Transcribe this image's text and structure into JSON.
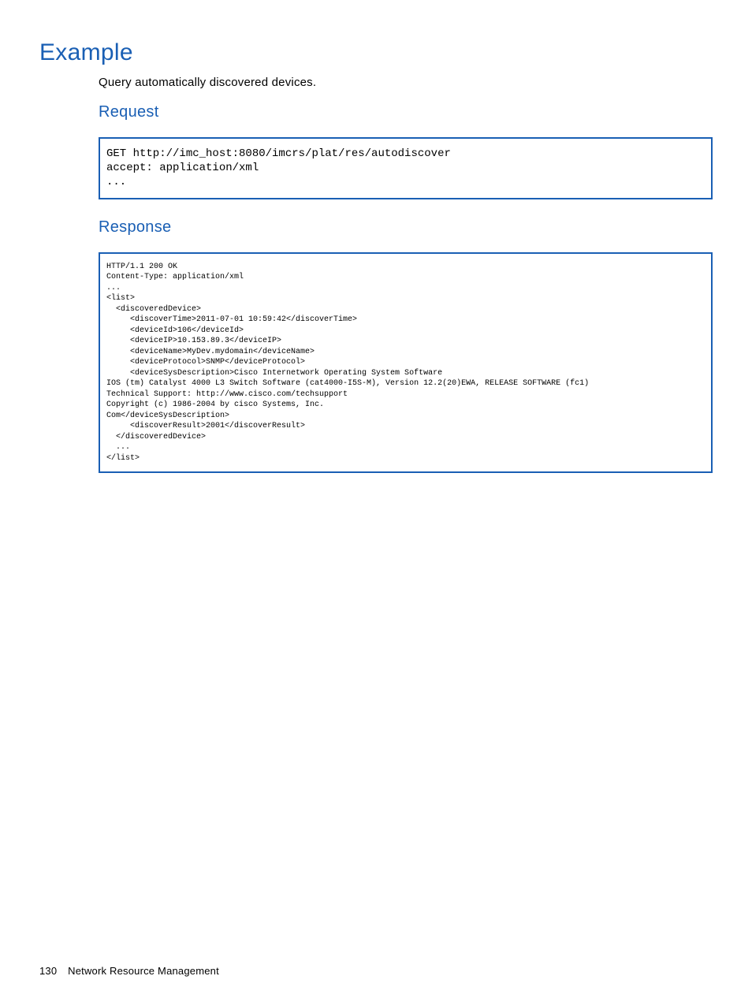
{
  "section": {
    "title": "Example",
    "intro": "Query automatically discovered devices."
  },
  "request": {
    "heading": "Request",
    "code": "GET http://imc_host:8080/imcrs/plat/res/autodiscover\naccept: application/xml\n..."
  },
  "response": {
    "heading": "Response",
    "code": "HTTP/1.1 200 OK\nContent-Type: application/xml\n...\n<list>\n  <discoveredDevice>\n     <discoverTime>2011-07-01 10:59:42</discoverTime>\n     <deviceId>106</deviceId>\n     <deviceIP>10.153.89.3</deviceIP>\n     <deviceName>MyDev.mydomain</deviceName>\n     <deviceProtocol>SNMP</deviceProtocol>\n     <deviceSysDescription>Cisco Internetwork Operating System Software\nIOS (tm) Catalyst 4000 L3 Switch Software (cat4000-I5S-M), Version 12.2(20)EWA, RELEASE SOFTWARE (fc1)\nTechnical Support: http://www.cisco.com/techsupport\nCopyright (c) 1986-2004 by cisco Systems, Inc.\nCom</deviceSysDescription>\n     <discoverResult>2001</discoverResult>\n  </discoveredDevice>\n  ...\n</list>"
  },
  "footer": {
    "page": "130",
    "chapter": "Network Resource Management"
  }
}
